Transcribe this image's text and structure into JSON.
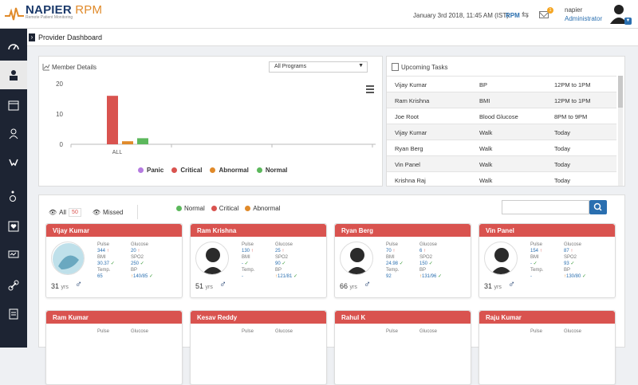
{
  "brand": {
    "name1": "NAPIER",
    "name2": "RPM",
    "tagline": "Remote Patient Monitoring"
  },
  "topbar": {
    "datetime": "January 3rd 2018, 11:45 AM (IST)",
    "rpm": "RPM",
    "notif_count": "1",
    "user_name": "napier",
    "user_role": "Administrator"
  },
  "page": {
    "title": "Provider Dashboard"
  },
  "member_details": {
    "title": "Member Details",
    "program": "All Programs"
  },
  "chart_data": {
    "type": "bar",
    "categories": [
      "ALL"
    ],
    "series": [
      {
        "name": "Panic",
        "color": "#b57be0",
        "values": [
          0
        ]
      },
      {
        "name": "Critical",
        "color": "#d9534f",
        "values": [
          16
        ]
      },
      {
        "name": "Abnormal",
        "color": "#e08a2a",
        "values": [
          1
        ]
      },
      {
        "name": "Normal",
        "color": "#5cb85c",
        "values": [
          2
        ]
      }
    ],
    "ylim": [
      0,
      20
    ],
    "yticks": [
      "20",
      "10",
      "0"
    ],
    "legend_position": "bottom"
  },
  "tasks": {
    "title": "Upcoming Tasks",
    "rows": [
      {
        "name": "Vijay Kumar",
        "task": "BP",
        "time": "12PM to 1PM"
      },
      {
        "name": "Ram Krishna",
        "task": "BMI",
        "time": "12PM to 1PM"
      },
      {
        "name": "Joe Root",
        "task": "Blood Glucose",
        "time": "8PM to 9PM"
      },
      {
        "name": "Vijay Kumar",
        "task": "Walk",
        "time": "Today"
      },
      {
        "name": "Ryan Berg",
        "task": "Walk",
        "time": "Today"
      },
      {
        "name": "Vin Panel",
        "task": "Walk",
        "time": "Today"
      },
      {
        "name": "Krishna Raj",
        "task": "Walk",
        "time": "Today"
      }
    ]
  },
  "filters": {
    "all_label": "All",
    "all_count": "50",
    "missed_label": "Missed",
    "normal": "Normal",
    "critical": "Critical",
    "abnormal": "Abnormal"
  },
  "labels": {
    "pulse": "Pulse",
    "glucose": "Glucose",
    "bmi": "BMI",
    "spo2": "SPO2",
    "temp": "Temp.",
    "bp": "BP",
    "yrs": "yrs"
  },
  "members": [
    {
      "name": "Vijay Kumar",
      "age": "31",
      "pulse": "344",
      "glucose": "20",
      "bmi": "30.37",
      "spo2": "250",
      "temp": "65",
      "bp": "140/85",
      "photo": true
    },
    {
      "name": "Ram Krishna",
      "age": "51",
      "pulse": "130",
      "glucose": "25",
      "bmi": "-",
      "spo2": "90",
      "temp": "-",
      "bp": "121/81",
      "photo": false
    },
    {
      "name": "Ryan Berg",
      "age": "66",
      "pulse": "70",
      "glucose": "6",
      "bmi": "24.98",
      "spo2": "150",
      "temp": "92",
      "bp": "131/96",
      "photo": false
    },
    {
      "name": "Vin Panel",
      "age": "31",
      "pulse": "154",
      "glucose": "87",
      "bmi": "-",
      "spo2": "93",
      "temp": "-",
      "bp": "130/80",
      "photo": false
    },
    {
      "name": "Ram Kumar"
    },
    {
      "name": "Kesav Reddy"
    },
    {
      "name": "Rahul K"
    },
    {
      "name": "Raju Kumar"
    }
  ]
}
